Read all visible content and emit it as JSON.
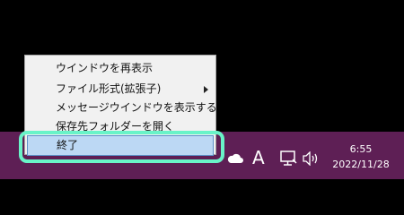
{
  "context_menu": {
    "items": [
      {
        "label": "ウインドウを再表示"
      },
      {
        "label": "ファイル形式(拡張子)"
      },
      {
        "label": "メッセージウインドウを表示する"
      },
      {
        "label": "保存先フォルダーを開く"
      }
    ],
    "selected_item": {
      "label": "終了"
    }
  },
  "taskbar": {
    "tray": {
      "cloud_icon": "onedrive-cloud-icon",
      "ime_indicator": "A",
      "network_icon": "network-icon",
      "volume_icon": "volume-icon"
    },
    "clock": {
      "time": "6:55",
      "date": "2022/11/28"
    }
  },
  "colors": {
    "taskbar": "#5e1f55",
    "menu_background": "#f1f1f1",
    "selection": "#bcd8f4",
    "highlight_ring": "#69f3c8"
  }
}
